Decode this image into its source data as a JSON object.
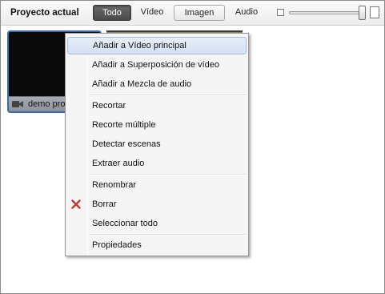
{
  "toolbar": {
    "title": "Proyecto actual",
    "filters": [
      {
        "label": "Todo",
        "active": true
      },
      {
        "label": "Vídeo",
        "active": false
      },
      {
        "label": "Imagen",
        "active": false
      },
      {
        "label": "Audio",
        "active": false
      }
    ],
    "zoom_icons": [
      "zoom-out-icon",
      "zoom-in-icon"
    ],
    "zoom_level": 1.0
  },
  "clips": [
    {
      "name": "demo pro",
      "type_icon": "video-camera-icon",
      "selected": true
    }
  ],
  "context_menu": {
    "items": [
      {
        "label": "Añadir a Vídeo principal",
        "highlighted": true
      },
      {
        "label": "Añadir a Superposición de vídeo"
      },
      {
        "label": "Añadir a Mezcla de audio"
      },
      {
        "label": "Recortar"
      },
      {
        "label": "Recorte múltiple"
      },
      {
        "label": "Detectar escenas"
      },
      {
        "label": "Extraer audio"
      },
      {
        "label": "Renombrar"
      },
      {
        "label": "Borrar",
        "icon": "delete-x-icon"
      },
      {
        "label": "Seleccionar todo"
      },
      {
        "label": "Propiedades"
      }
    ]
  },
  "colors": {
    "selection_border": "#3b68b8",
    "active_filter": "#4a4a4a",
    "delete_icon": "#c0392b",
    "menu_highlight": "#d4e0f2"
  }
}
